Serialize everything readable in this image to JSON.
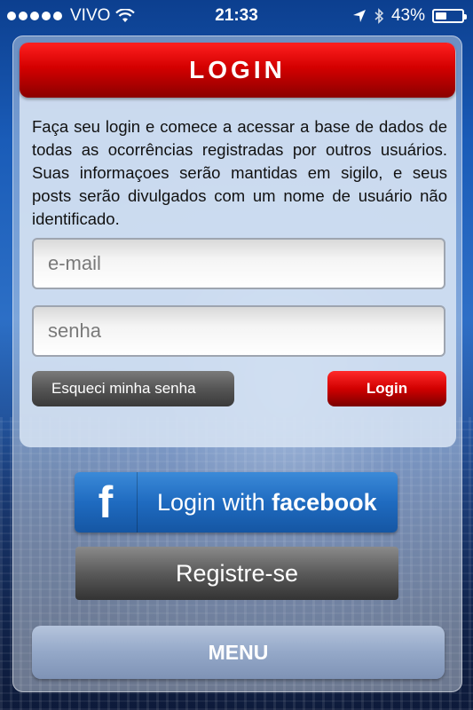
{
  "status_bar": {
    "carrier": "VIVO",
    "time": "21:33",
    "battery_text": "43%",
    "battery_level": 0.43,
    "icons": [
      "signal-dots-icon",
      "wifi-icon",
      "location-arrow-icon",
      "bluetooth-icon",
      "battery-icon"
    ]
  },
  "header": {
    "title": "LOGIN"
  },
  "intro_text": "Faça seu login e comece a acessar a base de dados de todas as ocorrências registradas por outros usuários. Suas informaçoes serão mantidas em sigilo, e seus posts serão divulgados com um nome de usuário não identificado.",
  "form": {
    "email_placeholder": "e-mail",
    "password_placeholder": "senha",
    "forgot_label": "Esqueci minha senha",
    "login_label": "Login"
  },
  "facebook": {
    "logo": "f",
    "prefix": "Login with ",
    "brand": "facebook"
  },
  "register_label": "Registre-se",
  "menu_label": "MENU",
  "colors": {
    "accent_red": "#d40000",
    "facebook_blue": "#1f6bc0",
    "menu_blue": "#94a8c8"
  }
}
